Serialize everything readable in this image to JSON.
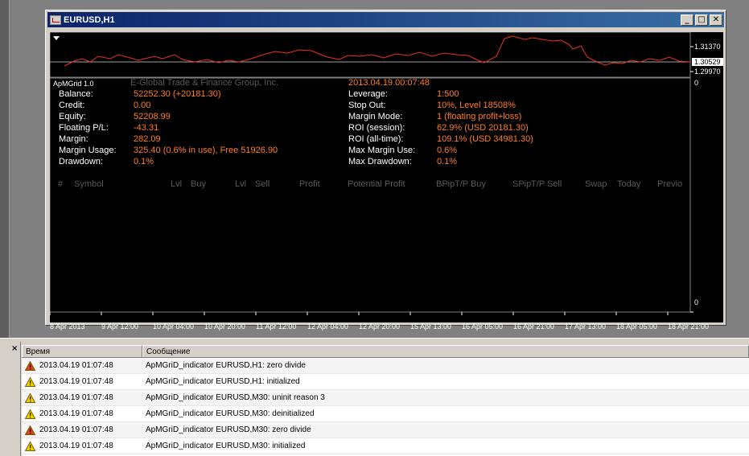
{
  "window": {
    "title": "EURUSD,H1",
    "min_icon": "minimize-icon",
    "max_icon": "maximize-icon",
    "close_icon": "close-icon"
  },
  "prices": {
    "top": "1.31370",
    "current": "1.30529",
    "bottom": "1.29970",
    "ind_top": "0",
    "ind_bottom": "0"
  },
  "indicator": {
    "name": "ApMGrid 1.0",
    "broker": "E-Global Trade & Finance Group, Inc.",
    "datetime": "2013.04.19 00:07:48",
    "left": [
      {
        "label": "Balance:",
        "value": "52252.30 (+20181.30)"
      },
      {
        "label": "Credit:",
        "value": "0.00"
      },
      {
        "label": "Equity:",
        "value": "52208.99"
      },
      {
        "label": "Floating P/L:",
        "value": "-43.31"
      },
      {
        "label": "Margin:",
        "value": "282.09"
      },
      {
        "label": "Margin Usage:",
        "value": "325.40 (0.6% in use), Free 51926.90"
      },
      {
        "label": "Drawdown:",
        "value": "0.1%"
      }
    ],
    "right": [
      {
        "label": "Leverage:",
        "value": "1:500"
      },
      {
        "label": "Stop Out:",
        "value": "10%, Level 18508%"
      },
      {
        "label": "Margin Mode:",
        "value": "1 (floating profit+loss)"
      },
      {
        "label": "ROI (session):",
        "value": "62.9% (USD 20181.30)"
      },
      {
        "label": "ROI (all-time):",
        "value": "109.1% (USD 34981.30)"
      },
      {
        "label": "Max Margin Use:",
        "value": "0.6%"
      },
      {
        "label": "Max Drawdown:",
        "value": "0.1%"
      }
    ],
    "table_headers": [
      "#",
      "Symbol",
      "Lvl",
      "Buy",
      "Lvl",
      "Sell",
      "Profit",
      "Potential Profit",
      "BPip",
      "T/P Buy",
      "SPip",
      "T/P Sell",
      "Swap",
      "Today",
      "Previo"
    ]
  },
  "time_axis": [
    "8 Apr 2013",
    "9 Apr 12:00",
    "10 Apr 04:00",
    "10 Apr 20:00",
    "11 Apr 12:00",
    "12 Apr 04:00",
    "12 Apr 20:00",
    "15 Apr 13:00",
    "16 Apr 05:00",
    "16 Apr 21:00",
    "17 Apr 13:00",
    "18 Apr 05:00",
    "18 Apr 21:00"
  ],
  "journal": {
    "col_time": "Время",
    "col_msg": "Сообщение",
    "rows": [
      {
        "icon": "error-warning-icon",
        "time": "2013.04.19 01:07:48",
        "msg": "ApMGriD_indicator EURUSD,H1: zero divide"
      },
      {
        "icon": "warning-icon",
        "time": "2013.04.19 01:07:48",
        "msg": "ApMGriD_indicator EURUSD,H1: initialized"
      },
      {
        "icon": "warning-icon",
        "time": "2013.04.19 01:07:48",
        "msg": "ApMGriD_indicator EURUSD,M30: uninit reason 3"
      },
      {
        "icon": "warning-icon",
        "time": "2013.04.19 01:07:48",
        "msg": "ApMGriD_indicator EURUSD,M30: deinitialized"
      },
      {
        "icon": "error-warning-icon",
        "time": "2013.04.19 01:07:48",
        "msg": "ApMGriD_indicator EURUSD,M30: zero divide"
      },
      {
        "icon": "warning-icon",
        "time": "2013.04.19 01:07:48",
        "msg": "ApMGriD_indicator EURUSD,M30: initialized"
      }
    ]
  },
  "colors": {
    "price_line": "#e8331c",
    "value_text": "#ff7f27",
    "title_bar": "#0a246a"
  }
}
